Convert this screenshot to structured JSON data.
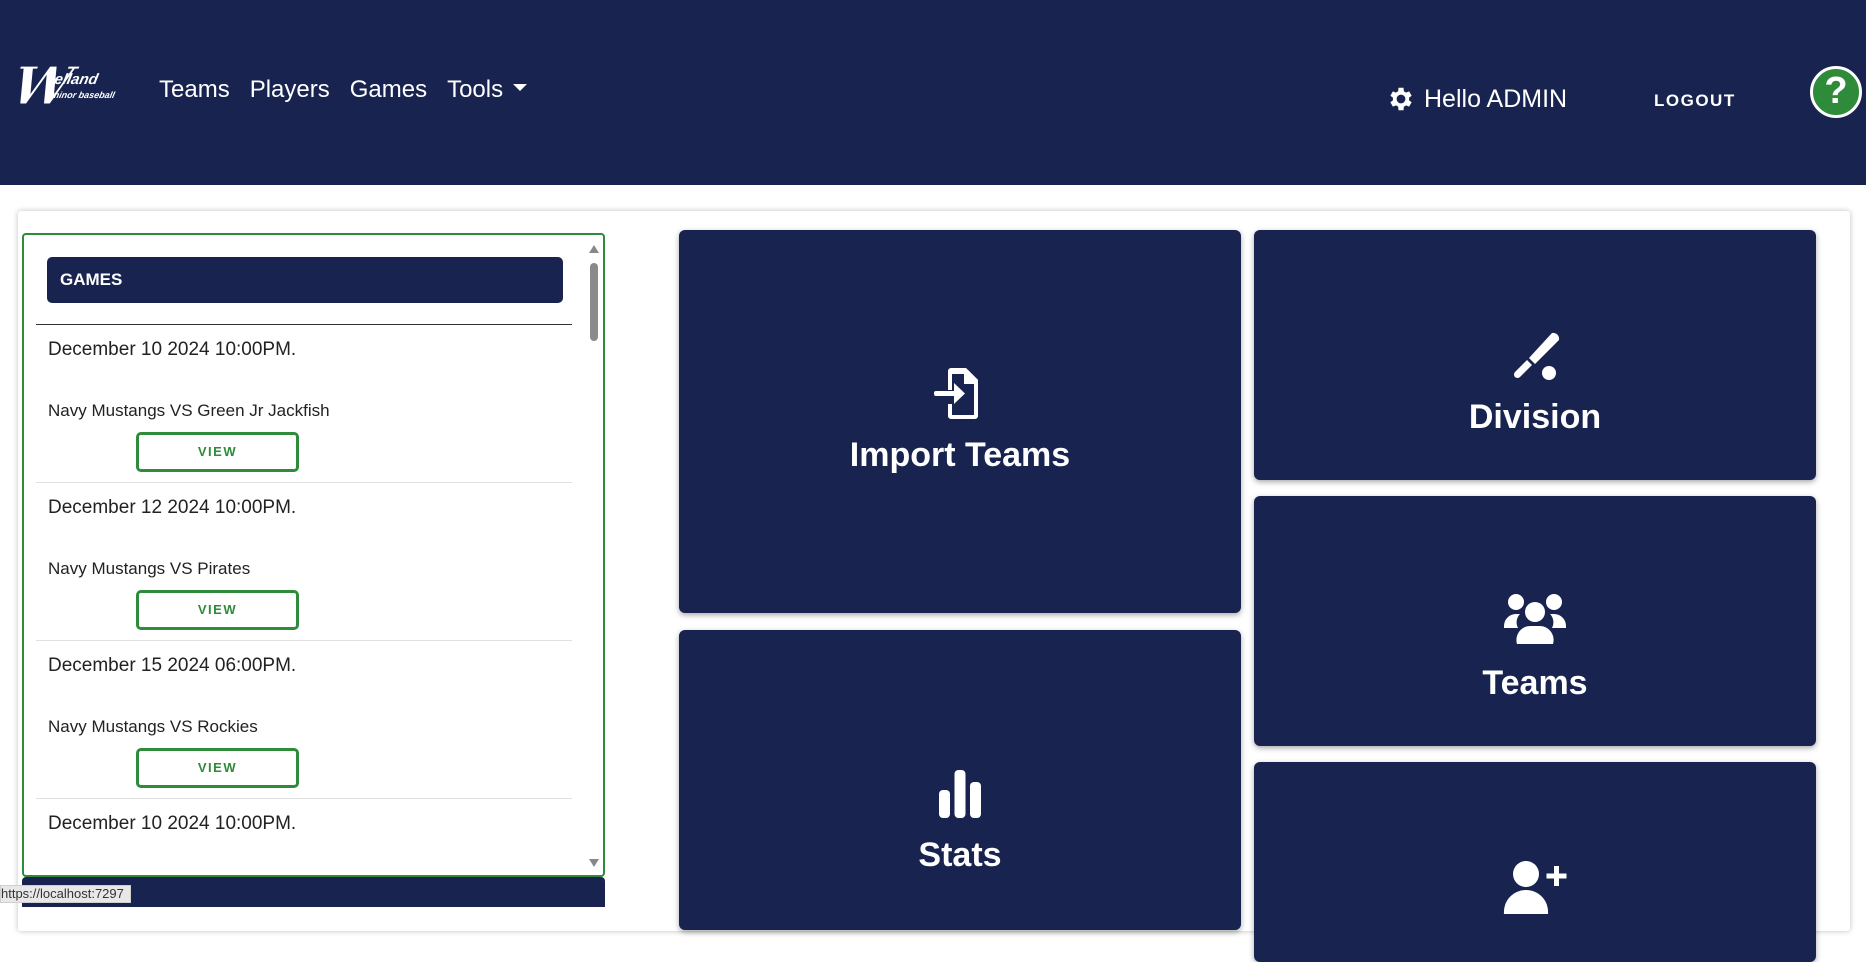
{
  "header": {
    "brand": "Welland minor baseball",
    "nav": [
      {
        "label": "Teams"
      },
      {
        "label": "Players"
      },
      {
        "label": "Games"
      },
      {
        "label": "Tools"
      }
    ],
    "greeting": "Hello ADMIN",
    "logout_label": "LOGOUT",
    "help_label": "?"
  },
  "games_panel": {
    "title": "GAMES",
    "items": [
      {
        "date": "December 10 2024 10:00PM.",
        "matchup": "Navy Mustangs VS Green Jr Jackfish",
        "view_label": "VIEW"
      },
      {
        "date": "December 12 2024 10:00PM.",
        "matchup": "Navy Mustangs VS Pirates",
        "view_label": "VIEW"
      },
      {
        "date": "December 15 2024 06:00PM.",
        "matchup": "Navy Mustangs VS Rockies",
        "view_label": "VIEW"
      },
      {
        "date": "December 10 2024 10:00PM.",
        "matchup": "",
        "view_label": ""
      }
    ]
  },
  "tiles": {
    "import_teams": {
      "label": "Import Teams",
      "icon": "file-import-icon"
    },
    "division": {
      "label": "Division",
      "icon": "baseball-bat-ball-icon"
    },
    "teams": {
      "label": "Teams",
      "icon": "users-icon"
    },
    "stats": {
      "label": "Stats",
      "icon": "bar-chart-icon"
    },
    "add_player": {
      "label": "",
      "icon": "user-plus-icon"
    }
  },
  "status_bar": {
    "url": "https://localhost:7297"
  },
  "colors": {
    "navy": "#18244f",
    "green": "#2e8b3a",
    "white": "#ffffff"
  }
}
